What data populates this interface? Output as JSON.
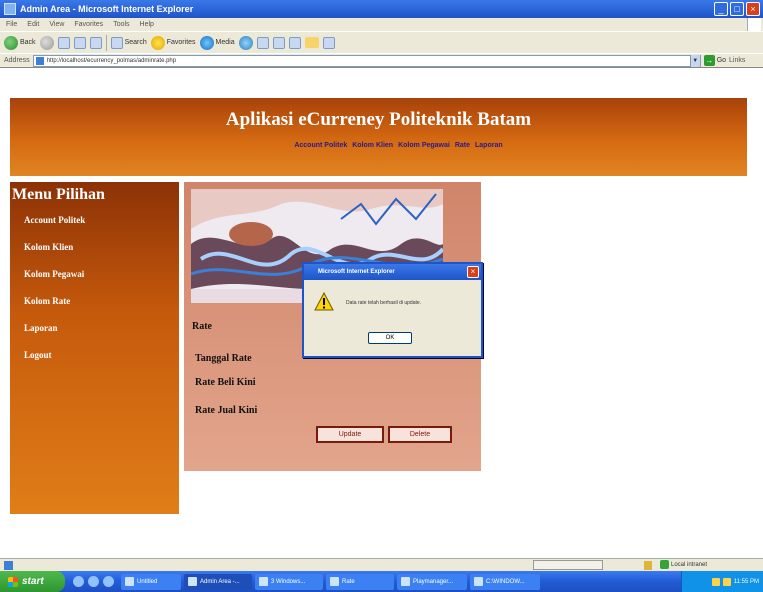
{
  "window": {
    "title": "Admin Area - Microsoft Internet Explorer",
    "minimize": "_",
    "maximize": "□",
    "close": "×"
  },
  "menubar": [
    "File",
    "Edit",
    "View",
    "Favorites",
    "Tools",
    "Help"
  ],
  "toolbar": {
    "back": "Back",
    "search": "Search",
    "favorites": "Favorites",
    "media": "Media"
  },
  "address": {
    "label": "Address",
    "url": "http://localhost/ecurrency_polmas/adminrate.php",
    "go": "Go",
    "links": "Links"
  },
  "page": {
    "title": "Aplikasi eCurreney Politeknik Batam",
    "nav": [
      "Account Politek",
      "Kolom Klien",
      "Kolom Pegawai",
      "Rate",
      "Laporan"
    ],
    "menu_heading": "Menu Pilihan",
    "menu": [
      "Account Politek",
      "Kolom Klien",
      "Kolom Pegawai",
      "Kolom Rate",
      "Laporan",
      "Logout"
    ],
    "rate_heading": "Rate",
    "labels": {
      "tanggal_rate": "Tanggal Rate",
      "rate_beli": "Rate Beli Kini",
      "rate_jual": "Rate Jual Kini"
    },
    "buttons": {
      "update": "Update",
      "delete": "Delete"
    }
  },
  "dialog": {
    "title": "Microsoft Internet Explorer",
    "message": "Data rate telah berhasil di update.",
    "ok": "OK",
    "close": "×"
  },
  "statusbar": {
    "zone": "Local intranet"
  },
  "taskbar": {
    "start": "start",
    "tasks": [
      "Untitled",
      "Admin Area -...",
      "3 Windows...",
      "Rate",
      "Playmanager...",
      "C:\\WINDOW..."
    ],
    "clock": "11:55 PM"
  }
}
